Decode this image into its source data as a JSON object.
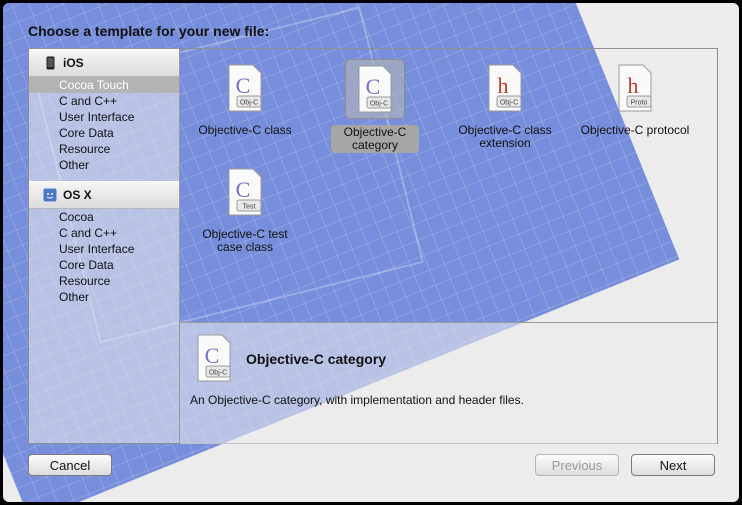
{
  "dialog": {
    "title": "Choose a template for your new file:"
  },
  "sidebar": {
    "sections": [
      {
        "header": "iOS",
        "icon": "iphone-icon",
        "items": [
          "Cocoa Touch",
          "C and C++",
          "User Interface",
          "Core Data",
          "Resource",
          "Other"
        ],
        "selected_index": 0
      },
      {
        "header": "OS X",
        "icon": "mac-os-icon",
        "items": [
          "Cocoa",
          "C and C++",
          "User Interface",
          "Core Data",
          "Resource",
          "Other"
        ]
      }
    ]
  },
  "templates": [
    {
      "label": "Objective-C class",
      "badge": "Obj-C",
      "glyph": "C",
      "icon": "class-file-icon"
    },
    {
      "label": "Objective-C category",
      "badge": "Obj-C",
      "glyph": "C",
      "icon": "category-file-icon",
      "selected": true
    },
    {
      "label": "Objective-C class extension",
      "badge": "Obj-C",
      "glyph": "h",
      "icon": "extension-file-icon"
    },
    {
      "label": "Objective-C protocol",
      "badge": "Proto",
      "glyph": "h",
      "icon": "protocol-file-icon"
    },
    {
      "label": "Objective-C test case class",
      "badge": "Test",
      "glyph": "C",
      "icon": "test-file-icon"
    }
  ],
  "description": {
    "title": "Objective-C category",
    "badge": "Obj-C",
    "glyph": "C",
    "text": "An Objective-C category, with implementation and header files."
  },
  "buttons": {
    "cancel": "Cancel",
    "previous": "Previous",
    "next": "Next"
  },
  "colors": {
    "selection": "#b3b3b3",
    "blueprint": "#4f6fd6",
    "glyph_purple": "#7a6fc8",
    "glyph_red": "#c0392b"
  }
}
